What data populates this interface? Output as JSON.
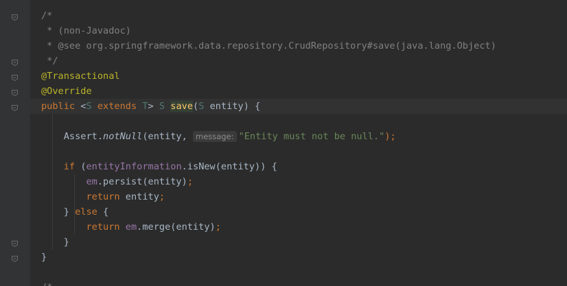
{
  "editor": {
    "lines": [
      {
        "segments": [
          {
            "text": "/*",
            "style": "cmt"
          }
        ]
      },
      {
        "segments": [
          {
            "text": " * (non-Javadoc)",
            "style": "cmt"
          }
        ]
      },
      {
        "segments": [
          {
            "text": " * @see org.springframework.data.repository.CrudRepository#save(java.lang.Object)",
            "style": "cmt"
          }
        ]
      },
      {
        "segments": [
          {
            "text": " */",
            "style": "cmt"
          }
        ]
      },
      {
        "segments": [
          {
            "text": "@Transactional",
            "style": "ann"
          }
        ]
      },
      {
        "segments": [
          {
            "text": "@Override",
            "style": "ann"
          }
        ]
      },
      {
        "segments": [
          {
            "text": "public ",
            "style": "kw"
          },
          {
            "text": "<",
            "style": "plain"
          },
          {
            "text": "S",
            "style": "tp"
          },
          {
            "text": " extends ",
            "style": "kw"
          },
          {
            "text": "T",
            "style": "tp"
          },
          {
            "text": "> ",
            "style": "plain"
          },
          {
            "text": "S",
            "style": "tp"
          },
          {
            "text": " ",
            "style": "plain"
          },
          {
            "text": "save",
            "style": "method-hl"
          },
          {
            "text": "(",
            "style": "plain"
          },
          {
            "text": "S",
            "style": "tp"
          },
          {
            "text": " entity) {",
            "style": "plain"
          }
        ]
      },
      {
        "segments": []
      },
      {
        "segments": [
          {
            "text": "    Assert.",
            "style": "plain"
          },
          {
            "text": "notNull",
            "style": "plain italic"
          },
          {
            "text": "(entity, ",
            "style": "plain"
          },
          {
            "text": "message:",
            "style": "hint"
          },
          {
            "text": "\"Entity must not be null.\"",
            "style": "str"
          },
          {
            "text": ");",
            "style": "kw"
          }
        ]
      },
      {
        "segments": []
      },
      {
        "segments": [
          {
            "text": "    ",
            "style": "plain"
          },
          {
            "text": "if ",
            "style": "kw"
          },
          {
            "text": "(",
            "style": "plain"
          },
          {
            "text": "entityInformation",
            "style": "fld"
          },
          {
            "text": ".isNew(entity)) {",
            "style": "plain"
          }
        ]
      },
      {
        "segments": [
          {
            "text": "        ",
            "style": "plain"
          },
          {
            "text": "em",
            "style": "fld"
          },
          {
            "text": ".persist(entity)",
            "style": "plain"
          },
          {
            "text": ";",
            "style": "kw"
          }
        ]
      },
      {
        "segments": [
          {
            "text": "        ",
            "style": "plain"
          },
          {
            "text": "return ",
            "style": "kw"
          },
          {
            "text": "entity",
            "style": "plain"
          },
          {
            "text": ";",
            "style": "kw"
          }
        ]
      },
      {
        "segments": [
          {
            "text": "    } ",
            "style": "plain"
          },
          {
            "text": "else ",
            "style": "kw"
          },
          {
            "text": "{",
            "style": "plain"
          }
        ]
      },
      {
        "segments": [
          {
            "text": "        ",
            "style": "plain"
          },
          {
            "text": "return ",
            "style": "kw"
          },
          {
            "text": "em",
            "style": "fld"
          },
          {
            "text": ".merge(entity)",
            "style": "plain"
          },
          {
            "text": ";",
            "style": "kw"
          }
        ]
      },
      {
        "segments": [
          {
            "text": "    }",
            "style": "plain"
          }
        ]
      },
      {
        "segments": [
          {
            "text": "}",
            "style": "plain"
          }
        ]
      },
      {
        "segments": []
      },
      {
        "segments": [
          {
            "text": "/*",
            "style": "cmt"
          }
        ]
      }
    ],
    "current_line": 6,
    "fold_markers": [
      0,
      3,
      4,
      5,
      6,
      15,
      16,
      18
    ]
  },
  "colors": {
    "background": "#2b2b2b",
    "gutter": "#313335",
    "comment": "#808080",
    "annotation": "#bbb529",
    "keyword": "#cc7832",
    "type_param": "#507874",
    "field": "#9876aa",
    "string": "#6a8759",
    "method_decl": "#ffc66d",
    "plain": "#a9b7c6"
  }
}
